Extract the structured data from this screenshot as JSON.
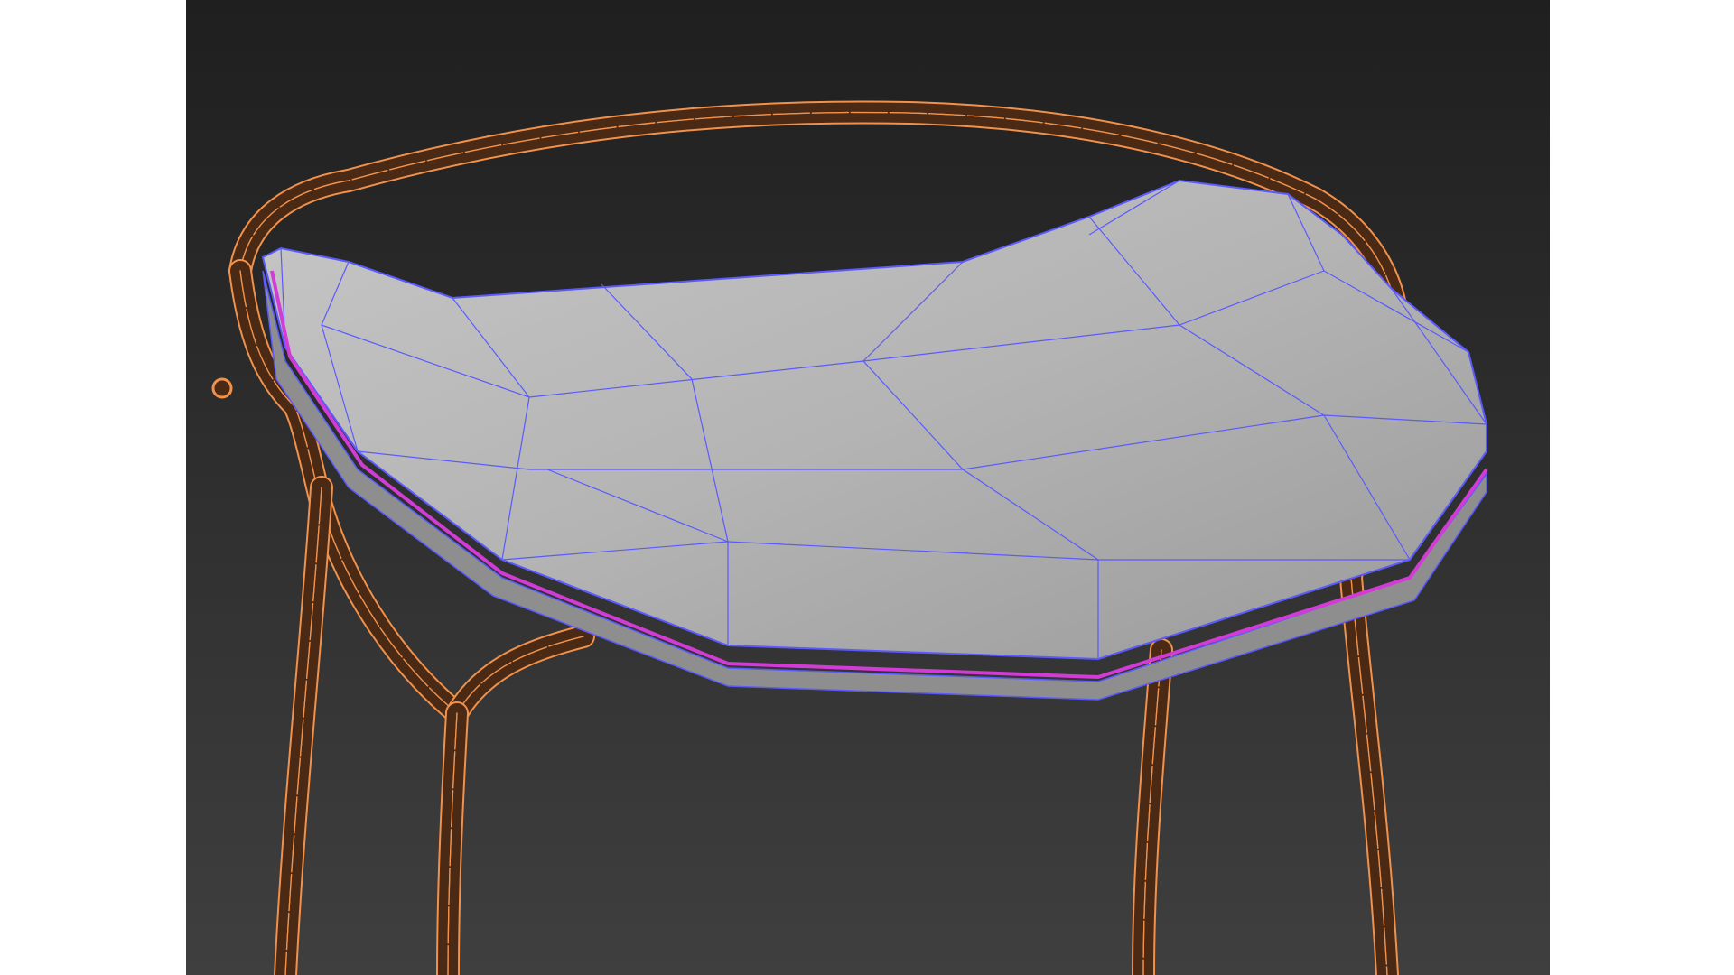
{
  "viewport": {
    "background_top": "#1f1f1f",
    "background_bottom": "#3f3f3f",
    "side_margin_color": "#ffffff"
  },
  "frame_wire": {
    "color": "#f0914c",
    "shade": "#4a2a14"
  },
  "seat": {
    "fill_light": "#c6c6c6",
    "fill_dark": "#9a9a9a",
    "wire_color": "#5a5aff",
    "selected_edge_color": "#d23bd6"
  }
}
